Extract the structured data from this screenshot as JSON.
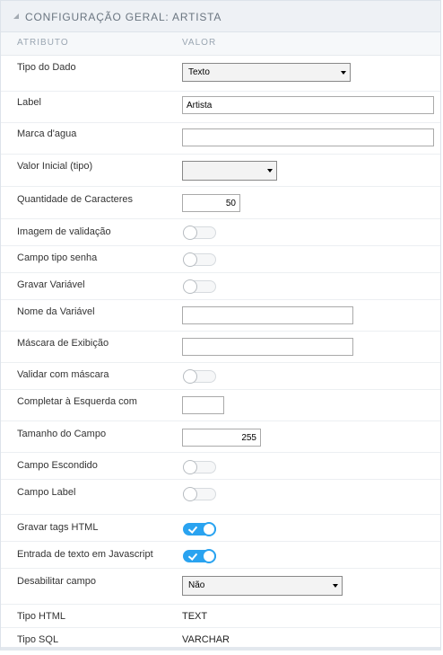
{
  "header": {
    "title": "CONFIGURAÇÃO GERAL: ARTISTA"
  },
  "columns": {
    "attribute": "ATRIBUTO",
    "value": "VALOR"
  },
  "fields": {
    "tipo_dado": {
      "label": "Tipo do Dado",
      "value": "Texto"
    },
    "label": {
      "label": "Label",
      "value": "Artista"
    },
    "marca_agua": {
      "label": "Marca d'agua",
      "value": ""
    },
    "valor_inicial": {
      "label": "Valor Inicial (tipo)",
      "value": ""
    },
    "qtd_caracteres": {
      "label": "Quantidade de Caracteres",
      "value": "50"
    },
    "imagem_validacao": {
      "label": "Imagem de validação",
      "checked": false
    },
    "campo_senha": {
      "label": "Campo tipo senha",
      "checked": false
    },
    "gravar_variavel": {
      "label": "Gravar Variável",
      "checked": false
    },
    "nome_variavel": {
      "label": "Nome da Variável",
      "value": ""
    },
    "mascara_exibicao": {
      "label": "Máscara de Exibição",
      "value": ""
    },
    "validar_mascara": {
      "label": "Validar com máscara",
      "checked": false
    },
    "completar_esquerda": {
      "label": "Completar à Esquerda com",
      "value": ""
    },
    "tamanho_campo": {
      "label": "Tamanho do Campo",
      "value": "255"
    },
    "campo_escondido": {
      "label": "Campo Escondido",
      "checked": false
    },
    "campo_label": {
      "label": "Campo Label",
      "checked": false
    },
    "gravar_tags_html": {
      "label": "Gravar tags HTML",
      "checked": true
    },
    "entrada_javascript": {
      "label": "Entrada de texto em Javascript",
      "checked": true
    },
    "desabilitar_campo": {
      "label": "Desabilitar campo",
      "value": "Não"
    },
    "tipo_html": {
      "label": "Tipo HTML",
      "value": "TEXT"
    },
    "tipo_sql": {
      "label": "Tipo SQL",
      "value": "VARCHAR"
    }
  },
  "colors": {
    "toggle_on": "#2aa3f0",
    "header_bg": "#eef1f5"
  }
}
